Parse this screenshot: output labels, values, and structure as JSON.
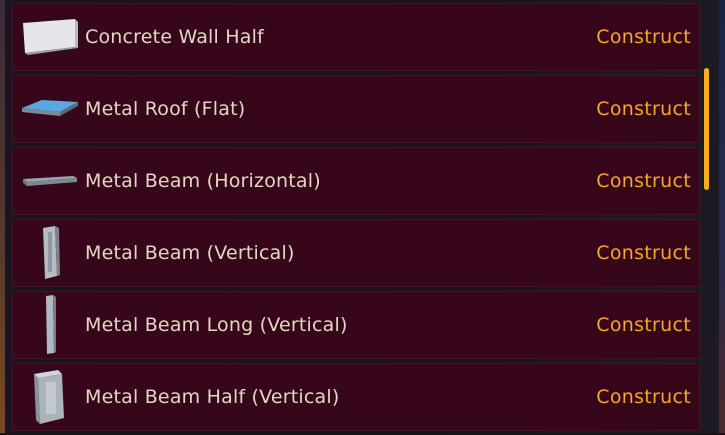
{
  "build_menu": {
    "items": [
      {
        "name": "Concrete Wall Half",
        "action": "Construct",
        "icon": "concrete-wall-half-icon"
      },
      {
        "name": "Metal Roof (Flat)",
        "action": "Construct",
        "icon": "metal-roof-flat-icon"
      },
      {
        "name": "Metal Beam (Horizontal)",
        "action": "Construct",
        "icon": "metal-beam-horizontal-icon"
      },
      {
        "name": "Metal Beam (Vertical)",
        "action": "Construct",
        "icon": "metal-beam-vertical-icon"
      },
      {
        "name": "Metal Beam Long (Vertical)",
        "action": "Construct",
        "icon": "metal-beam-long-vertical-icon"
      },
      {
        "name": "Metal Beam Half (Vertical)",
        "action": "Construct",
        "icon": "metal-beam-half-vertical-icon"
      }
    ]
  },
  "colors": {
    "row_background": "#36071a",
    "action_text": "#f5a623",
    "item_text": "#e4d6c4",
    "scrollbar": "#f5b11c"
  }
}
